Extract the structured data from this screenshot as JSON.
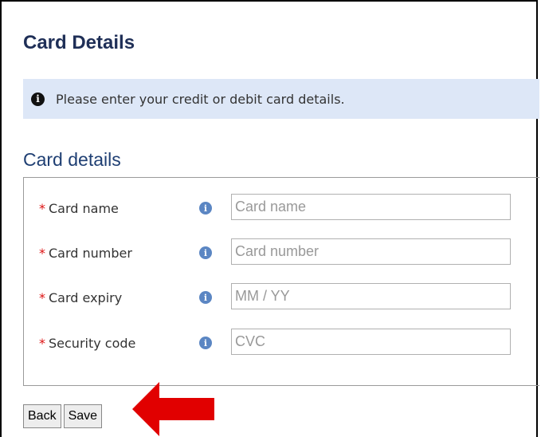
{
  "header": {
    "title": "Card Details"
  },
  "banner": {
    "icon": "info-icon",
    "text": "Please enter your credit or debit card details."
  },
  "section": {
    "title": "Card details"
  },
  "fields": [
    {
      "label": "Card name",
      "required_mark": "*",
      "placeholder": "Card name",
      "value": ""
    },
    {
      "label": "Card number",
      "required_mark": "*",
      "placeholder": "Card number",
      "value": ""
    },
    {
      "label": "Card expiry",
      "required_mark": "*",
      "placeholder": "MM / YY",
      "value": ""
    },
    {
      "label": "Security code",
      "required_mark": "*",
      "placeholder": "CVC",
      "value": ""
    }
  ],
  "buttons": {
    "back": "Back",
    "save": "Save"
  },
  "annotation": {
    "icon": "red-arrow-icon",
    "color": "#e10000"
  },
  "colors": {
    "title": "#1f2f57",
    "banner_bg": "#dde7f7",
    "section_title": "#1f3f73",
    "required": "#d11111",
    "info_icon": "#5b86c3"
  }
}
